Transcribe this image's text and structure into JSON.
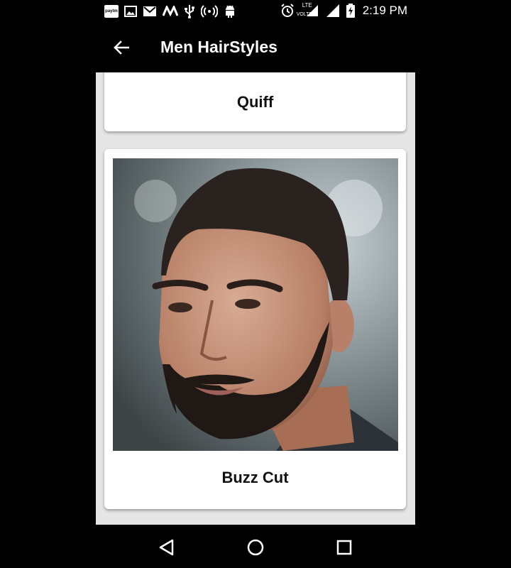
{
  "status_bar": {
    "time": "2:19 PM",
    "paytm_label": "paytm",
    "left_icons": [
      "paytm-icon",
      "gallery-icon",
      "gmail-icon",
      "moto-icon",
      "usb-icon",
      "hotspot-icon",
      "android-icon"
    ],
    "right_icons": [
      "alarm-icon",
      "volte-lte-icon",
      "signal-icon",
      "battery-charging-icon"
    ],
    "lte_label": "LTE",
    "volte_label": "VOLTE"
  },
  "app_bar": {
    "title": "Men HairStyles",
    "back_icon": "arrow-back-icon"
  },
  "cards": [
    {
      "label": "Quiff"
    },
    {
      "label": "Buzz Cut"
    }
  ],
  "nav_bar": {
    "icons": [
      "back-triangle-icon",
      "home-circle-icon",
      "recents-square-icon"
    ]
  },
  "colors": {
    "bar_background": "#000000",
    "list_background": "#e6e6e6",
    "card_background": "#ffffff"
  }
}
